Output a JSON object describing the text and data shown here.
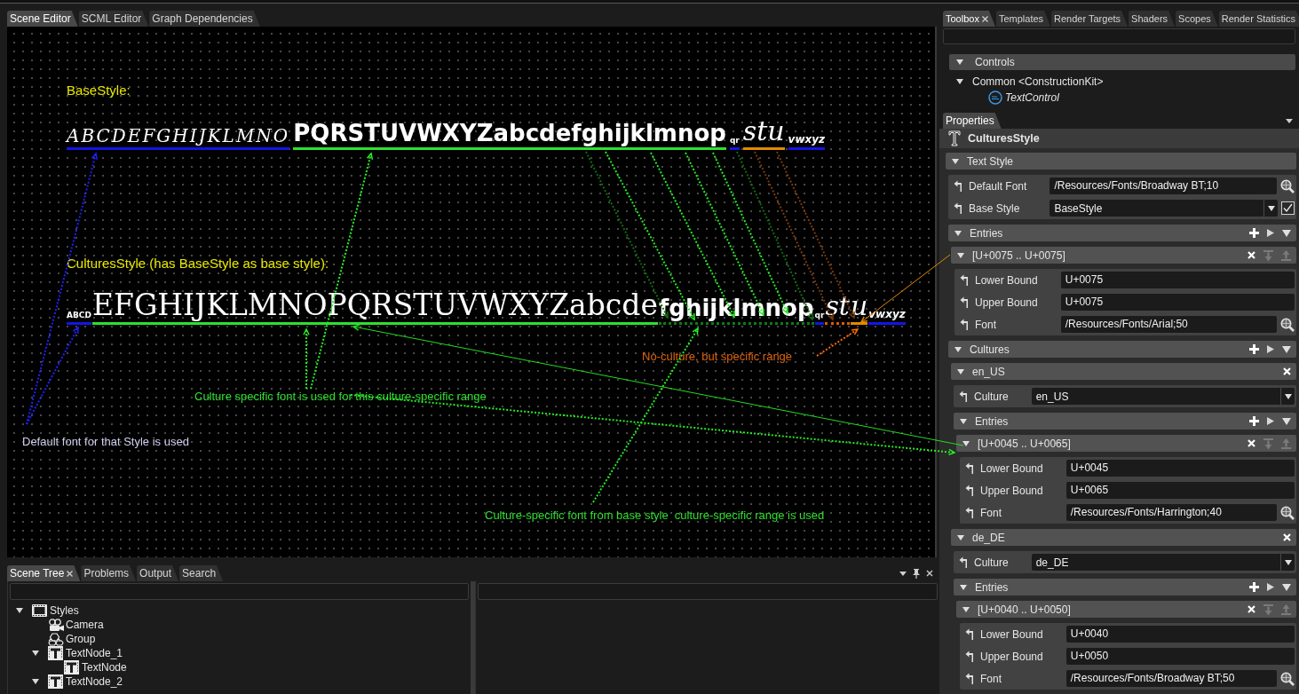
{
  "editor_tabs": [
    {
      "label": "Scene Editor",
      "selected": true
    },
    {
      "label": "SCML Editor",
      "selected": false
    },
    {
      "label": "Graph Dependencies",
      "selected": false
    }
  ],
  "canvas": {
    "styles": [
      {
        "heading": "BaseStyle:",
        "segments": [
          {
            "text": "ABCDEFGHIJKLMNO",
            "kind": "script",
            "color": "#1414e6",
            "dotted": false
          },
          {
            "text": "PQRSTUVWXYZabcdefghijklmnop",
            "kind": "display",
            "color": "#2ee02e",
            "dotted": false
          },
          {
            "text": "qr",
            "kind": "tiny",
            "color": "#1414e6",
            "dotted": false
          },
          {
            "text": "stu",
            "kind": "flourish",
            "color": "#e08a00",
            "dotted": false
          },
          {
            "text": "vwxyz",
            "kind": "small",
            "color": "#1414e6",
            "dotted": false
          }
        ]
      },
      {
        "heading": "CulturesStyle (has BaseStyle as base style):",
        "segments": [
          {
            "text": "ABCD",
            "kind": "tiny",
            "color": "#1414e6",
            "dotted": false
          },
          {
            "text": "EFGHIJKLMNOPQRSTUVWXYZabcde",
            "kind": "serif",
            "color": "#2ee02e",
            "dotted": false
          },
          {
            "text": "fghijklmnop",
            "kind": "display",
            "color": "#0f7a0f",
            "dotted": true
          },
          {
            "text": "qr",
            "kind": "tiny",
            "color": "#1414e6",
            "dotted": false
          },
          {
            "text": "st",
            "kind": "flourish",
            "color": "#e05a00",
            "dotted": true
          },
          {
            "text": "u",
            "kind": "flourish",
            "color": "#e08a00",
            "dotted": false
          },
          {
            "text": "vwxyz",
            "kind": "small",
            "color": "#1414e6",
            "dotted": false
          }
        ]
      }
    ],
    "notes": [
      {
        "text": "No-culture, but specific range",
        "color": "#e0650a"
      },
      {
        "text": "Culture specific font is used for this culture-specific range",
        "color": "#2ee02e"
      },
      {
        "text": "Default font for that Style is used",
        "color": "#cfcfef"
      },
      {
        "text": "Culture-specific font from base style  culture-specific range is used",
        "color": "#2ee02e"
      }
    ]
  },
  "scene_tree": {
    "tabs": [
      {
        "label": "Scene Tree",
        "selected": true,
        "closable": true
      },
      {
        "label": "Problems",
        "selected": false,
        "closable": false
      },
      {
        "label": "Output",
        "selected": false,
        "closable": false
      },
      {
        "label": "Search",
        "selected": false,
        "closable": false
      }
    ],
    "nodes": [
      {
        "label": "Styles",
        "kind": "styles",
        "expanded": true,
        "children": [
          {
            "label": "Camera",
            "kind": "camera"
          },
          {
            "label": "Group",
            "kind": "group"
          },
          {
            "label": "TextNode_1",
            "kind": "text",
            "expanded": true,
            "children": [
              {
                "label": "TextNode",
                "kind": "text"
              }
            ]
          },
          {
            "label": "TextNode_2",
            "kind": "text",
            "expanded": true
          }
        ]
      }
    ]
  },
  "toolbox": {
    "tabs": [
      {
        "label": "Toolbox",
        "selected": true,
        "closable": true
      },
      {
        "label": "Templates",
        "selected": false,
        "closable": false
      },
      {
        "label": "Render Targets",
        "selected": false,
        "closable": false
      },
      {
        "label": "Shaders",
        "selected": false,
        "closable": false
      },
      {
        "label": "Scopes",
        "selected": false,
        "closable": false
      },
      {
        "label": "Render Statistics",
        "selected": false,
        "closable": false
      }
    ],
    "groups": [
      {
        "label": "Controls",
        "expanded": true,
        "children": [
          {
            "label": "Common <ConstructionKit>",
            "expanded": true,
            "children": [
              {
                "label": "TextControl",
                "kind": "control"
              }
            ]
          }
        ]
      }
    ]
  },
  "properties": {
    "tabs": [
      {
        "label": "Properties",
        "selected": true
      }
    ],
    "title": "CulturesStyle",
    "items": [
      {
        "kind": "group",
        "label": "Text Style",
        "expanded": true,
        "children": [
          {
            "kind": "font",
            "label": "Default Font",
            "value": "/Resources/Fonts/Broadway BT;10"
          },
          {
            "kind": "dropdown",
            "label": "Base Style",
            "value": "BaseStyle",
            "checked": true
          },
          {
            "kind": "collection",
            "label": "Entries",
            "expanded": true,
            "children": [
              {
                "kind": "range",
                "label": "[U+0075 .. U+0075]",
                "expanded": true,
                "movable": false,
                "children": [
                  {
                    "kind": "text",
                    "label": "Lower Bound",
                    "value": "U+0075"
                  },
                  {
                    "kind": "text",
                    "label": "Upper Bound",
                    "value": "U+0075"
                  },
                  {
                    "kind": "font",
                    "label": "Font",
                    "value": "/Resources/Fonts/Arial;50"
                  }
                ]
              }
            ]
          },
          {
            "kind": "collection",
            "label": "Cultures",
            "expanded": true,
            "children": [
              {
                "kind": "culture",
                "label": "en_US",
                "expanded": true,
                "children": [
                  {
                    "kind": "dropdown",
                    "label": "Culture",
                    "value": "en_US"
                  },
                  {
                    "kind": "collection",
                    "label": "Entries",
                    "expanded": true,
                    "children": [
                      {
                        "kind": "range",
                        "label": "[U+0045 .. U+0065]",
                        "expanded": true,
                        "movable": false,
                        "children": [
                          {
                            "kind": "text",
                            "label": "Lower Bound",
                            "value": "U+0045"
                          },
                          {
                            "kind": "text",
                            "label": "Upper Bound",
                            "value": "U+0065"
                          },
                          {
                            "kind": "font",
                            "label": "Font",
                            "value": "/Resources/Fonts/Harrington;40"
                          }
                        ]
                      }
                    ]
                  }
                ]
              },
              {
                "kind": "culture",
                "label": "de_DE",
                "expanded": true,
                "children": [
                  {
                    "kind": "dropdown",
                    "label": "Culture",
                    "value": "de_DE"
                  },
                  {
                    "kind": "collection",
                    "label": "Entries",
                    "expanded": true,
                    "children": [
                      {
                        "kind": "range",
                        "label": "[U+0040 .. U+0050]",
                        "expanded": true,
                        "movable": false,
                        "children": [
                          {
                            "kind": "text",
                            "label": "Lower Bound",
                            "value": "U+0040"
                          },
                          {
                            "kind": "text",
                            "label": "Upper Bound",
                            "value": "U+0050"
                          },
                          {
                            "kind": "font",
                            "label": "Font",
                            "value": "/Resources/Fonts/Broadway BT;50"
                          }
                        ]
                      }
                    ]
                  }
                ]
              }
            ]
          }
        ]
      }
    ]
  }
}
